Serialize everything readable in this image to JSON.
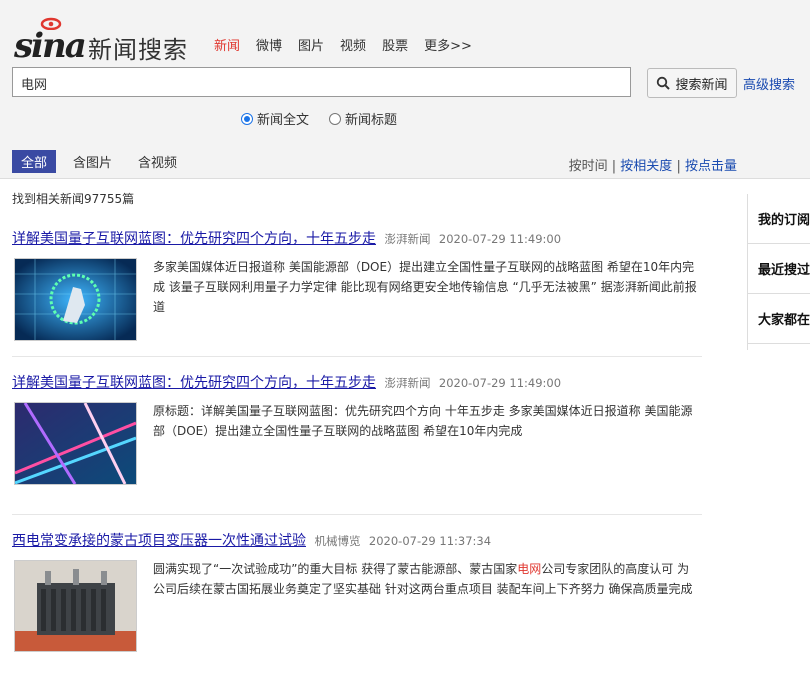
{
  "header": {
    "logo_text": "sina",
    "title": "新闻搜索",
    "nav": [
      {
        "label": "新闻",
        "active": true
      },
      {
        "label": "微博",
        "active": false
      },
      {
        "label": "图片",
        "active": false
      },
      {
        "label": "视频",
        "active": false
      },
      {
        "label": "股票",
        "active": false
      },
      {
        "label": "更多>>",
        "active": false
      }
    ],
    "accent_color": "#e0372f"
  },
  "search": {
    "query": "电网",
    "button_label": "搜索新闻",
    "button_icon": "search-icon",
    "advanced_label": "高级搜索",
    "scope_options": [
      {
        "label": "新闻全文",
        "selected": true
      },
      {
        "label": "新闻标题",
        "selected": false
      }
    ]
  },
  "filters": {
    "tabs": [
      "全部",
      "含图片",
      "含视频"
    ],
    "active_tab": "全部",
    "sort": [
      "按时间",
      "按相关度",
      "按点击量"
    ],
    "sort_separator": "|"
  },
  "result_count": "找到相关新闻97755篇",
  "results": [
    {
      "title": "详解美国量子互联网蓝图：优先研究四个方向，十年五步走",
      "source": "澎湃新闻",
      "time": "2020-07-29 11:49:00",
      "desc": "多家美国媒体近日报道称 美国能源部（DOE）提出建立全国性量子互联网的战略蓝图 希望在10年内完成 该量子互联网利用量子力学定律 能比现有网络更安全地传输信息 “几乎无法被黑” 据澎湃新闻此前报道"
    },
    {
      "title": "详解美国量子互联网蓝图：优先研究四个方向，十年五步走",
      "source": "澎湃新闻",
      "time": "2020-07-29 11:49:00",
      "desc": "原标题：详解美国量子互联网蓝图：优先研究四个方向 十年五步走 多家美国媒体近日报道称 美国能源部（DOE）提出建立全国性量子互联网的战略蓝图 希望在10年内完成"
    },
    {
      "title": "西电常变承接的蒙古项目变压器一次性通过试验",
      "source": "机械博览",
      "time": "2020-07-29 11:37:34",
      "desc_before": "圆满实现了“一次试验成功”的重大目标 获得了蒙古能源部、蒙古国家",
      "desc_highlight": "电网",
      "desc_after": "公司专家团队的高度认可 为公司后续在蒙古国拓展业务奠定了坚实基础 针对这两台重点项目 装配车间上下齐努力 确保高质量完成"
    }
  ],
  "sidebar": {
    "items": [
      "我的订阅",
      "最近搜过",
      "大家都在搜"
    ]
  }
}
